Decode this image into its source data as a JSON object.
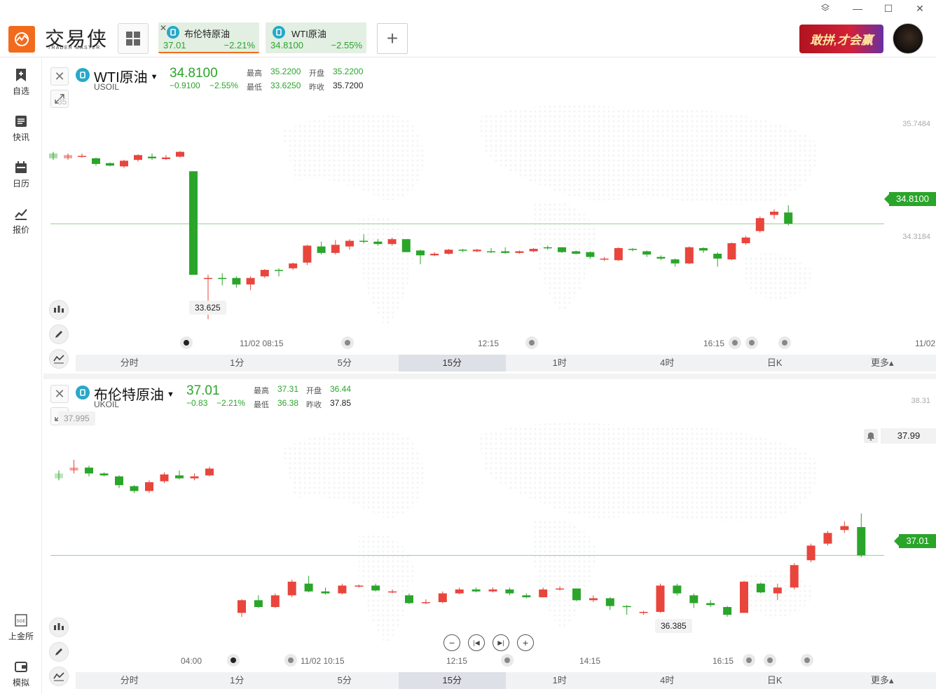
{
  "app": {
    "name_cn": "交易侠",
    "name_en": "TRADER MASTER"
  },
  "tabs": [
    {
      "name": "布伦特原油",
      "price": "37.01",
      "change": "−2.21%"
    },
    {
      "name": "WTI原油",
      "price": "34.8100",
      "change": "−2.55%"
    }
  ],
  "banner_text": "敢拼,才会赢",
  "sidebar": [
    {
      "label": "自选",
      "icon": "bookmark-plus-icon"
    },
    {
      "label": "快讯",
      "icon": "news-icon"
    },
    {
      "label": "日历",
      "icon": "calendar-icon"
    },
    {
      "label": "报价",
      "icon": "quote-trend-icon"
    },
    {
      "label": "上金所",
      "icon": "sge-icon"
    },
    {
      "label": "模拟",
      "icon": "wallet-icon"
    }
  ],
  "periods": [
    "分时",
    "1分",
    "5分",
    "15分",
    "1时",
    "4时",
    "日K",
    "更多▴"
  ],
  "active_period": "15分",
  "colors": {
    "up": "#e8453c",
    "down": "#2aa52a",
    "accent": "#f26b1d"
  },
  "wti": {
    "name": "WTI原油",
    "code": "USOIL",
    "price": "34.8100",
    "change": "−0.9100",
    "change_pct": "−2.55%",
    "labels": {
      "high": "最高",
      "open": "开盘",
      "low": "最低",
      "prev": "昨收"
    },
    "high": "35.2200",
    "open": "35.2200",
    "low": "33.6250",
    "prev_close": "35.7200",
    "axis": [
      "35.7484",
      "34.3184"
    ],
    "price_tag": "34.8100",
    "low_callout": "33.625",
    "faint_label": "35",
    "times": [
      "11/02 08:15",
      "12:15",
      "16:15",
      "11/02"
    ]
  },
  "brent": {
    "name": "布伦特原油",
    "code": "UKOIL",
    "price": "37.01",
    "change": "−0.83",
    "change_pct": "−2.21%",
    "labels": {
      "high": "最高",
      "open": "开盘",
      "low": "最低",
      "prev": "昨收"
    },
    "high": "37.31",
    "open": "36.44",
    "low": "36.38",
    "prev_close": "37.85",
    "axis": [
      "38.31",
      "37.99"
    ],
    "price_tag": "37.01",
    "alert_price": "37.99",
    "low_callout": "36.385",
    "high_callout": "37.995",
    "times": [
      "04:00",
      "11/02 10:15",
      "12:15",
      "14:15",
      "16:15"
    ]
  },
  "chart_data": [
    {
      "type": "candlestick",
      "title": "WTI原油",
      "ylim": [
        33.4,
        36.0
      ],
      "x": [
        "",
        "",
        "",
        "",
        "",
        "",
        "",
        "",
        "",
        "",
        "11/02 08:15",
        "",
        "",
        "",
        "",
        "",
        "",
        "",
        "",
        "",
        "",
        "",
        "",
        "",
        "",
        "",
        "",
        "",
        "12:15",
        "",
        "",
        "",
        "",
        "",
        "",
        "",
        "",
        "",
        "",
        "",
        "",
        "",
        "",
        "",
        "",
        "",
        "",
        "",
        "",
        "16:15",
        "",
        "",
        "",
        "",
        "",
        "11/02"
      ],
      "candles": [
        [
          35.68,
          35.62,
          35.7,
          35.6
        ],
        [
          35.62,
          35.66,
          35.68,
          35.6
        ],
        [
          35.65,
          35.65,
          35.68,
          35.63
        ],
        [
          35.62,
          35.55,
          35.63,
          35.53
        ],
        [
          35.56,
          35.53,
          35.57,
          35.52
        ],
        [
          35.52,
          35.59,
          35.6,
          35.5
        ],
        [
          35.6,
          35.66,
          35.67,
          35.58
        ],
        [
          35.64,
          35.62,
          35.68,
          35.6
        ],
        [
          35.61,
          35.63,
          35.66,
          35.6
        ],
        [
          35.64,
          35.7,
          35.71,
          35.63
        ],
        [
          35.46,
          34.18,
          35.46,
          34.18
        ],
        [
          34.14,
          34.14,
          34.18,
          33.63
        ],
        [
          34.14,
          34.13,
          34.2,
          34.05
        ],
        [
          34.14,
          34.06,
          34.16,
          34.02
        ],
        [
          34.06,
          34.14,
          34.16,
          33.99
        ],
        [
          34.16,
          34.24,
          34.25,
          34.14
        ],
        [
          34.24,
          34.23,
          34.26,
          34.16
        ],
        [
          34.26,
          34.32,
          34.33,
          34.24
        ],
        [
          34.33,
          34.54,
          34.55,
          34.3
        ],
        [
          34.53,
          34.45,
          34.59,
          34.43
        ],
        [
          34.45,
          34.55,
          34.61,
          34.43
        ],
        [
          34.53,
          34.6,
          34.62,
          34.49
        ],
        [
          34.6,
          34.59,
          34.68,
          34.57
        ],
        [
          34.59,
          34.56,
          34.62,
          34.54
        ],
        [
          34.56,
          34.62,
          34.64,
          34.54
        ],
        [
          34.62,
          34.46,
          34.62,
          34.46
        ],
        [
          34.48,
          34.42,
          34.49,
          34.31
        ],
        [
          34.42,
          34.44,
          34.46,
          34.41
        ],
        [
          34.44,
          34.49,
          34.5,
          34.43
        ],
        [
          34.49,
          34.48,
          34.5,
          34.46
        ],
        [
          34.47,
          34.49,
          34.5,
          34.46
        ],
        [
          34.47,
          34.46,
          34.51,
          34.45
        ],
        [
          34.47,
          34.45,
          34.52,
          34.44
        ],
        [
          34.45,
          34.47,
          34.48,
          34.44
        ],
        [
          34.47,
          34.5,
          34.51,
          34.46
        ],
        [
          34.52,
          34.51,
          34.54,
          34.49
        ],
        [
          34.52,
          34.46,
          34.52,
          34.45
        ],
        [
          34.47,
          34.44,
          34.48,
          34.43
        ],
        [
          34.46,
          34.4,
          34.47,
          34.38
        ],
        [
          34.38,
          34.38,
          34.4,
          34.35
        ],
        [
          34.36,
          34.51,
          34.52,
          34.35
        ],
        [
          34.5,
          34.49,
          34.51,
          34.47
        ],
        [
          34.47,
          34.43,
          34.48,
          34.4
        ],
        [
          34.4,
          34.38,
          34.42,
          34.36
        ],
        [
          34.37,
          34.32,
          34.38,
          34.28
        ],
        [
          34.32,
          34.52,
          34.53,
          34.31
        ],
        [
          34.51,
          34.48,
          34.52,
          34.45
        ],
        [
          34.44,
          34.38,
          34.46,
          34.28
        ],
        [
          34.37,
          34.57,
          34.58,
          34.36
        ],
        [
          34.57,
          34.64,
          34.66,
          34.55
        ],
        [
          34.72,
          34.88,
          34.9,
          34.7
        ],
        [
          34.92,
          34.96,
          34.99,
          34.87
        ],
        [
          34.95,
          34.81,
          35.04,
          34.79
        ]
      ]
    },
    {
      "type": "candlestick",
      "title": "布伦特原油",
      "ylim": [
        36.2,
        38.4
      ],
      "x": [
        "",
        "",
        "",
        "",
        "",
        "",
        "",
        "",
        "",
        "",
        "",
        "",
        "04:00",
        "",
        "",
        "",
        "11/02 10:15",
        "",
        "",
        "",
        "",
        "",
        "",
        "",
        "",
        "",
        "",
        "",
        "12:15",
        "",
        "",
        "",
        "",
        "",
        "",
        "",
        "14:15",
        "",
        "",
        "",
        "",
        "",
        "",
        "",
        "",
        "",
        "",
        "16:15",
        "",
        "",
        "",
        "",
        "",
        ""
      ],
      "candles": [
        [
          37.85,
          37.8,
          37.88,
          37.78
        ],
        [
          37.88,
          37.91,
          37.99,
          37.85
        ],
        [
          37.91,
          37.85,
          37.93,
          37.82
        ],
        [
          37.85,
          37.83,
          37.86,
          37.82
        ],
        [
          37.82,
          37.73,
          37.83,
          37.7
        ],
        [
          37.72,
          37.67,
          37.73,
          37.65
        ],
        [
          37.67,
          37.76,
          37.78,
          37.65
        ],
        [
          37.77,
          37.84,
          37.86,
          37.75
        ],
        [
          37.83,
          37.8,
          37.88,
          37.79
        ],
        [
          37.8,
          37.82,
          37.85,
          37.78
        ],
        [
          37.83,
          37.9,
          37.92,
          37.82
        ],
        [
          36.42,
          36.55,
          36.56,
          36.38
        ],
        [
          36.55,
          36.48,
          36.6,
          36.47
        ],
        [
          36.48,
          36.6,
          36.62,
          36.47
        ],
        [
          36.6,
          36.74,
          36.76,
          36.58
        ],
        [
          36.72,
          36.64,
          36.8,
          36.63
        ],
        [
          36.64,
          36.62,
          36.68,
          36.61
        ],
        [
          36.62,
          36.7,
          36.72,
          36.61
        ],
        [
          36.7,
          36.7,
          36.71,
          36.68
        ],
        [
          36.7,
          36.65,
          36.72,
          36.64
        ],
        [
          36.64,
          36.64,
          36.66,
          36.62
        ],
        [
          36.6,
          36.52,
          36.62,
          36.51
        ],
        [
          36.52,
          36.53,
          36.56,
          36.51
        ],
        [
          36.53,
          36.62,
          36.64,
          36.52
        ],
        [
          36.62,
          36.66,
          36.68,
          36.61
        ],
        [
          36.66,
          36.64,
          36.68,
          36.63
        ],
        [
          36.64,
          36.66,
          36.68,
          36.63
        ],
        [
          36.66,
          36.62,
          36.68,
          36.6
        ],
        [
          36.6,
          36.58,
          36.62,
          36.57
        ],
        [
          36.58,
          36.66,
          36.68,
          36.58
        ],
        [
          36.66,
          36.67,
          36.69,
          36.65
        ],
        [
          36.67,
          36.55,
          36.67,
          36.54
        ],
        [
          36.55,
          36.57,
          36.6,
          36.53
        ],
        [
          36.57,
          36.49,
          36.58,
          36.45
        ],
        [
          36.49,
          36.48,
          36.5,
          36.4
        ],
        [
          36.43,
          36.43,
          36.44,
          36.4
        ],
        [
          36.43,
          36.7,
          36.72,
          36.42
        ],
        [
          36.7,
          36.62,
          36.72,
          36.6
        ],
        [
          36.6,
          36.52,
          36.62,
          36.47
        ],
        [
          36.52,
          36.5,
          36.55,
          36.48
        ],
        [
          36.48,
          36.4,
          36.49,
          36.38
        ],
        [
          36.42,
          36.74,
          36.75,
          36.42
        ],
        [
          36.72,
          36.63,
          36.73,
          36.62
        ],
        [
          36.62,
          36.68,
          36.72,
          36.55
        ],
        [
          36.68,
          36.91,
          36.93,
          36.66
        ],
        [
          36.96,
          37.11,
          37.13,
          36.94
        ],
        [
          37.13,
          37.24,
          37.26,
          37.11
        ],
        [
          37.27,
          37.31,
          37.36,
          37.24
        ],
        [
          37.3,
          37.01,
          37.44,
          36.99
        ]
      ]
    }
  ]
}
